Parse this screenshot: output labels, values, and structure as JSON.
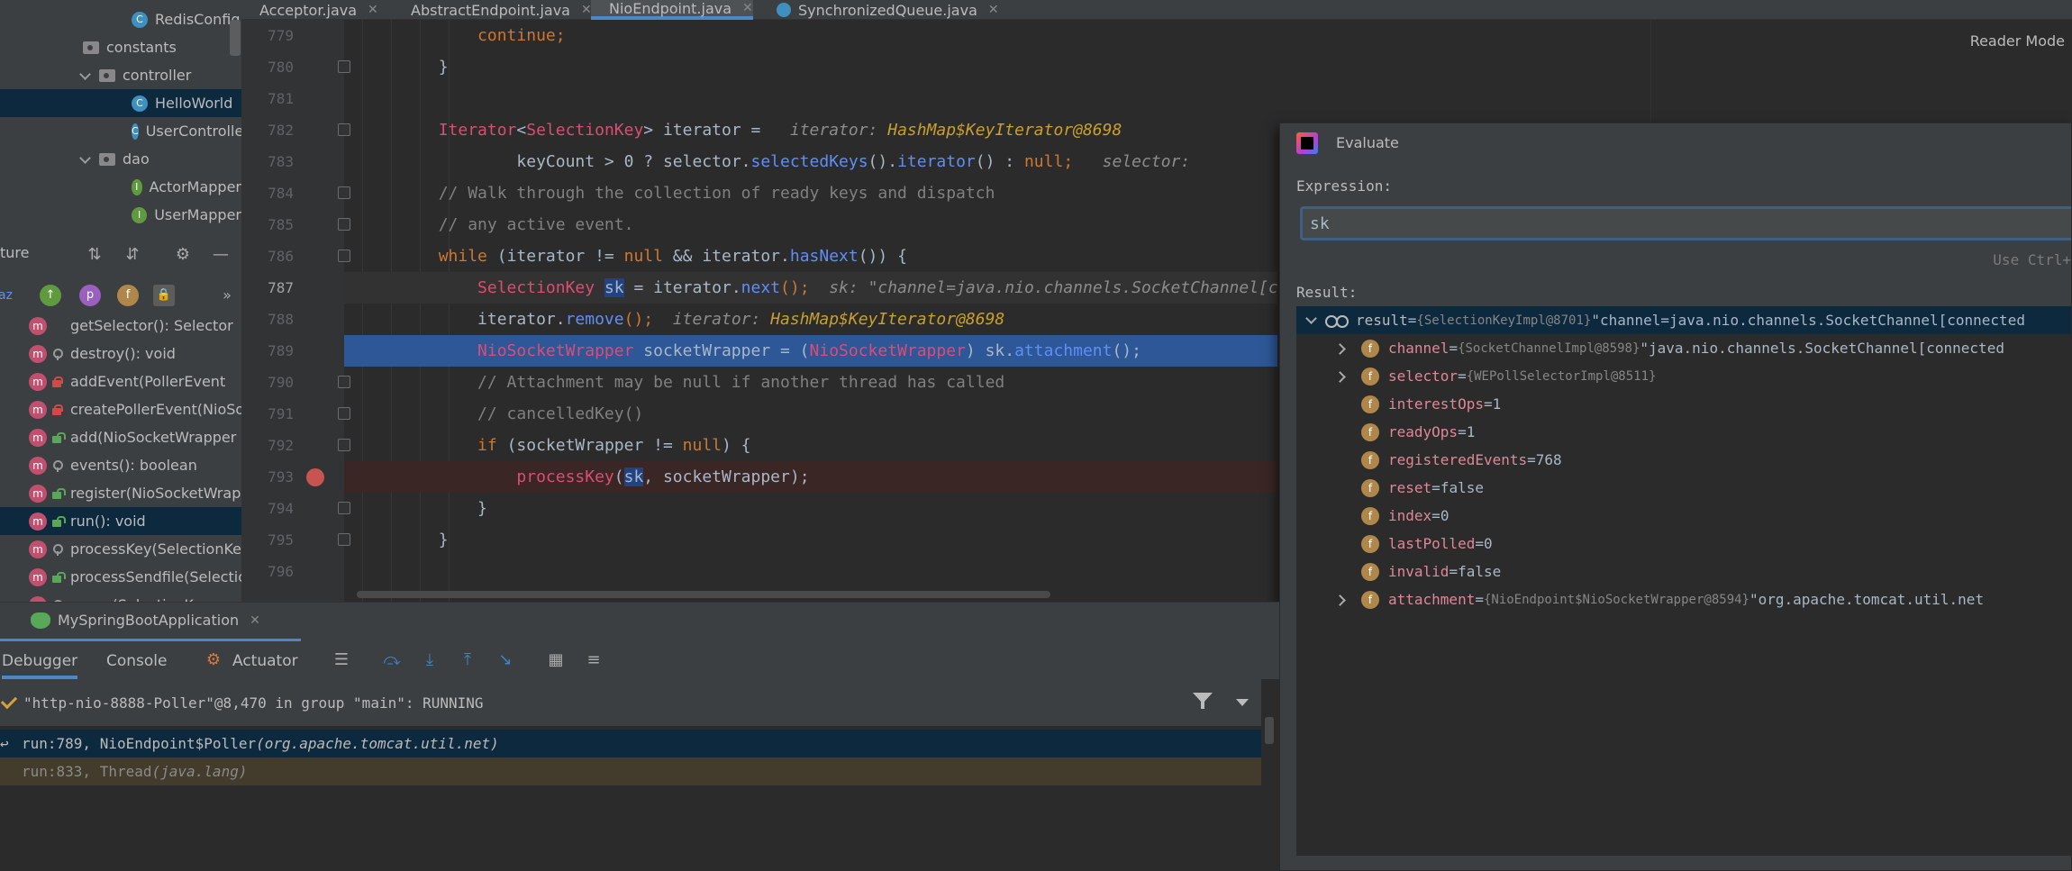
{
  "tabs": [
    {
      "label": "Acceptor.java",
      "active": false
    },
    {
      "label": "AbstractEndpoint.java",
      "active": false
    },
    {
      "label": "NioEndpoint.java",
      "active": true
    },
    {
      "label": "SynchronizedQueue.java",
      "active": false
    }
  ],
  "project_tree": [
    {
      "label": "RedisConfig",
      "kind": "class",
      "indent": 2
    },
    {
      "label": "constants",
      "kind": "package",
      "indent": 1
    },
    {
      "label": "controller",
      "kind": "package",
      "indent": 1,
      "expanded": true
    },
    {
      "label": "HelloWorld",
      "kind": "class",
      "indent": 2,
      "selected": true
    },
    {
      "label": "UserController",
      "kind": "class",
      "indent": 2
    },
    {
      "label": "dao",
      "kind": "package",
      "indent": 1,
      "expanded": true
    },
    {
      "label": "ActorMapper",
      "kind": "interface",
      "indent": 2
    },
    {
      "label": "UserMapper",
      "kind": "interface",
      "indent": 2
    }
  ],
  "structure": {
    "title": "ture",
    "members": [
      {
        "label": "getSelector(): Selector",
        "access": "none"
      },
      {
        "label": "destroy(): void",
        "access": "key"
      },
      {
        "label": "addEvent(PollerEvent",
        "access": "private"
      },
      {
        "label": "createPollerEvent(NioSocketWrapper",
        "access": "private"
      },
      {
        "label": "add(NioSocketWrapper",
        "access": "public"
      },
      {
        "label": "events(): boolean",
        "access": "key"
      },
      {
        "label": "register(NioSocketWrapper",
        "access": "public"
      },
      {
        "label": "run(): void",
        "access": "public",
        "selected": true
      },
      {
        "label": "processKey(SelectionKey",
        "access": "key"
      },
      {
        "label": "processSendfile(SelectionKey",
        "access": "public"
      },
      {
        "label": "unreg(SelectionKey",
        "access": "key"
      }
    ]
  },
  "editor": {
    "line_numbers": [
      "779",
      "780",
      "781",
      "782",
      "783",
      "784",
      "785",
      "786",
      "787",
      "788",
      "789",
      "790",
      "791",
      "792",
      "793",
      "794",
      "795",
      "796"
    ],
    "lines": [
      [
        {
          "t": "            ",
          "c": "var"
        },
        {
          "t": "continue",
          "c": "kw"
        },
        {
          "t": ";",
          "c": "kw"
        }
      ],
      [
        {
          "t": "        }",
          "c": "var"
        }
      ],
      [
        {
          "t": "",
          "c": "var"
        }
      ],
      [
        {
          "t": "        ",
          "c": "var"
        },
        {
          "t": "Iterator",
          "c": "ty"
        },
        {
          "t": "<",
          "c": "var"
        },
        {
          "t": "SelectionKey",
          "c": "ty"
        },
        {
          "t": "> iterator =   ",
          "c": "var"
        },
        {
          "t": "iterator: ",
          "c": "hint"
        },
        {
          "t": "HashMap$KeyIterator@8698",
          "c": "hint-t"
        }
      ],
      [
        {
          "t": "                keyCount > ",
          "c": "var"
        },
        {
          "t": "0",
          "c": "var"
        },
        {
          "t": " ? selector.",
          "c": "var"
        },
        {
          "t": "selectedKeys",
          "c": "fn"
        },
        {
          "t": "().",
          "c": "var"
        },
        {
          "t": "iterator",
          "c": "fn"
        },
        {
          "t": "() : ",
          "c": "var"
        },
        {
          "t": "null",
          "c": "kw"
        },
        {
          "t": ";   ",
          "c": "kw"
        },
        {
          "t": "selector:",
          "c": "hint"
        }
      ],
      [
        {
          "t": "        // Walk through the collection of ready keys and dispatch",
          "c": "cm"
        }
      ],
      [
        {
          "t": "        // any active event.",
          "c": "cm"
        }
      ],
      [
        {
          "t": "        ",
          "c": "var"
        },
        {
          "t": "while",
          "c": "kw"
        },
        {
          "t": " (iterator != ",
          "c": "var"
        },
        {
          "t": "null",
          "c": "kw"
        },
        {
          "t": " && iterator.",
          "c": "var"
        },
        {
          "t": "hasNext",
          "c": "fn"
        },
        {
          "t": "()) {",
          "c": "var"
        }
      ],
      [
        {
          "t": "            ",
          "c": "var"
        },
        {
          "t": "SelectionKey",
          "c": "ty"
        },
        {
          "t": " ",
          "c": "var"
        },
        {
          "t": "sk",
          "c": "sel-word"
        },
        {
          "t": " = iterator.",
          "c": "var"
        },
        {
          "t": "next",
          "c": "fn"
        },
        {
          "t": "();  ",
          "c": "kw"
        },
        {
          "t": "sk: \"channel=java.nio.channels.SocketChannel[connected",
          "c": "hint"
        }
      ],
      [
        {
          "t": "            iterator.",
          "c": "var"
        },
        {
          "t": "remove",
          "c": "fn"
        },
        {
          "t": "();  ",
          "c": "kw"
        },
        {
          "t": "iterator: ",
          "c": "hint"
        },
        {
          "t": "HashMap$KeyIterator@8698",
          "c": "hint-t"
        }
      ],
      [
        {
          "t": "            ",
          "c": "var"
        },
        {
          "t": "NioSocketWrapper",
          "c": "ty"
        },
        {
          "t": " socketWrapper = (",
          "c": "var"
        },
        {
          "t": "NioSocketWrapper",
          "c": "ty"
        },
        {
          "t": ") sk.",
          "c": "var"
        },
        {
          "t": "attachment",
          "c": "fn"
        },
        {
          "t": "();",
          "c": "var"
        }
      ],
      [
        {
          "t": "            // Attachment may be null if another thread has called",
          "c": "cm"
        }
      ],
      [
        {
          "t": "            // cancelledKey()",
          "c": "cm"
        }
      ],
      [
        {
          "t": "            ",
          "c": "var"
        },
        {
          "t": "if",
          "c": "kw"
        },
        {
          "t": " (socketWrapper != ",
          "c": "var"
        },
        {
          "t": "null",
          "c": "kw"
        },
        {
          "t": ") {",
          "c": "var"
        }
      ],
      [
        {
          "t": "                ",
          "c": "var"
        },
        {
          "t": "processKey",
          "c": "ty"
        },
        {
          "t": "(",
          "c": "var"
        },
        {
          "t": "sk",
          "c": "sel-word"
        },
        {
          "t": ", socketWrapper);",
          "c": "var"
        }
      ],
      [
        {
          "t": "            }",
          "c": "var"
        }
      ],
      [
        {
          "t": "        }",
          "c": "var"
        }
      ],
      [
        {
          "t": "",
          "c": "var"
        }
      ]
    ]
  },
  "reader_mode": "Reader Mode",
  "evaluate": {
    "title": "Evaluate",
    "expression_label": "Expression:",
    "expression_value": "sk",
    "use_ctrl_hint": "Use Ctrl+",
    "result_label": "Result:",
    "rows": [
      {
        "name": "result",
        "type": "{SelectionKeyImpl@8701}",
        "value": "\"channel=java.nio.channels.SocketChannel[connected",
        "root": true,
        "expanded": true
      },
      {
        "name": "channel",
        "type": "{SocketChannelImpl@8598}",
        "value": "\"java.nio.channels.SocketChannel[connected",
        "expandable": true
      },
      {
        "name": "selector",
        "type": "{WEPollSelectorImpl@8511}",
        "value": "",
        "expandable": true
      },
      {
        "name": "interestOps",
        "type": "",
        "value": "1"
      },
      {
        "name": "readyOps",
        "type": "",
        "value": "1"
      },
      {
        "name": "registeredEvents",
        "type": "",
        "value": "768"
      },
      {
        "name": "reset",
        "type": "",
        "value": "false"
      },
      {
        "name": "index",
        "type": "",
        "value": "0"
      },
      {
        "name": "lastPolled",
        "type": "",
        "value": "0"
      },
      {
        "name": "invalid",
        "type": "",
        "value": "false"
      },
      {
        "name": "attachment",
        "type": "{NioEndpoint$NioSocketWrapper@8594}",
        "value": "\"org.apache.tomcat.util.net",
        "expandable": true
      }
    ]
  },
  "run_config": "MySpringBootApplication",
  "debug_tabs": {
    "debugger": "Debugger",
    "console": "Console",
    "actuator": "Actuator"
  },
  "thread": "\"http-nio-8888-Poller\"@8,470 in group \"main\": RUNNING",
  "frames": [
    {
      "method": "run:789, NioEndpoint$Poller ",
      "pkg": "(org.apache.tomcat.util.net)",
      "selected": true
    },
    {
      "method": "run:833, Thread ",
      "pkg": "(java.lang)",
      "library": true
    }
  ],
  "colors": {
    "accent": "#4a88c7",
    "exec_line": "#2d5796",
    "breakpoint": "#c75450"
  }
}
